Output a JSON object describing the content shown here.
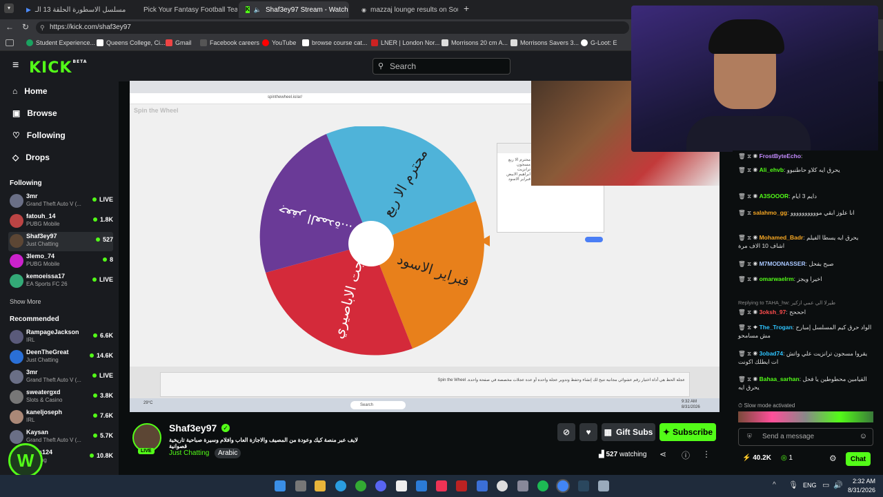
{
  "browser": {
    "tabs": [
      {
        "label": "مسلسل الاسطورة الحلقة 13 الـ"
      },
      {
        "label": "Pick Your Fantasy Football Team |"
      },
      {
        "label": "Shaf3ey97 Stream - Watch Li"
      },
      {
        "label": "mazzaj lounge results on Sou"
      }
    ],
    "url": "https://kick.com/shaf3ey97",
    "bookmarks": [
      "Student Experience...",
      "Queens College, Ci...",
      "Gmail",
      "Facebook careers",
      "YouTube",
      "browse course cat...",
      "LNER | London Nor...",
      "Morrisons 20 cm A...",
      "Morrisons Savers 3...",
      "G-Loot: E"
    ]
  },
  "header": {
    "logo": "KICK",
    "logo_badge": "BETA",
    "search_placeholder": "Search"
  },
  "sidebar": {
    "nav": [
      {
        "label": "Home"
      },
      {
        "label": "Browse"
      },
      {
        "label": "Following"
      },
      {
        "label": "Drops"
      }
    ],
    "following_title": "Following",
    "following": [
      {
        "name": "3mr",
        "game": "Grand Theft Auto V (...",
        "viewers": "LIVE"
      },
      {
        "name": "fatouh_14",
        "game": "PUBG Mobile",
        "viewers": "1.8K"
      },
      {
        "name": "Shaf3ey97",
        "game": "Just Chatting",
        "viewers": "527"
      },
      {
        "name": "3lemo_74",
        "game": "PUBG Mobile",
        "viewers": "8"
      },
      {
        "name": "kemoeissa17",
        "game": "EA Sports FC 26",
        "viewers": "LIVE"
      }
    ],
    "show_more": "Show More",
    "recommended_title": "Recommended",
    "recommended": [
      {
        "name": "RampageJackson",
        "game": "IRL",
        "viewers": "6.6K"
      },
      {
        "name": "DeenTheGreat",
        "game": "Just Chatting",
        "viewers": "14.6K"
      },
      {
        "name": "3mr",
        "game": "Grand Theft Auto V (...",
        "viewers": "LIVE"
      },
      {
        "name": "sweatergxd",
        "game": "Slots & Casino",
        "viewers": "3.8K"
      },
      {
        "name": "kaneljoseph",
        "game": "IRL",
        "viewers": "7.6K"
      },
      {
        "name": "Kaysan",
        "game": "Grand Theft Auto V (...",
        "viewers": "5.7K"
      },
      {
        "name": "clues124",
        "game": "Chatting",
        "viewers": "10.8K"
      }
    ]
  },
  "stream_screen": {
    "wheel_title": "Spin the Wheel",
    "inner_url": "spinthewheel.io/ar/",
    "segments": [
      "محترم الا ربع",
      "فبراير الاسود",
      "بهجت الاباصيري",
      "...جعفر العمدة"
    ],
    "entries_text": "محترم الا ربع\nمسجون ترانزيت\nابراهيم الابيض\nفبراير الاسود",
    "description": "عجلة الحظ هي أداة اختيار رقم عشوائي مجانية تتيح لك إنشاء وحفظ وتدوير عجلة واحدة أو عدة عجلات مخصصة في صفحة واحدة. Spin the Wheel",
    "inner_taskbar_search": "Search",
    "inner_time": "9:32 AM",
    "inner_date": "8/31/2026",
    "inner_weather": "29°C"
  },
  "channel": {
    "name": "Shaf3ey97",
    "live_badge": "LIVE",
    "title": "لايف عبر منصة كيك وعودة من المصيف والاجازة العاب وافلام وسيرة صباحية تاريخية قصوانية",
    "category": "Just Chatting",
    "language_tag": "Arabic",
    "watching_count": "527",
    "watching_label": "watching",
    "gift_label": "Gift Subs",
    "subscribe_label": "Subscribe"
  },
  "chat": {
    "messages": [
      {
        "user": "FrostByteEcho",
        "text": "",
        "color": "#c58cff"
      },
      {
        "user": "Ali_ehvb",
        "text": "يحرق ايه كلاو حاطنبوو",
        "color": "#53fc18"
      },
      {
        "user": "A3SOOOR",
        "text": "دايم 3 ايام",
        "color": "#53fc18"
      },
      {
        "user": "salahmo_gg",
        "text": "انا علوز ابقي موووووووووو",
        "color": "#f5a623"
      },
      {
        "user": "Mohamed_Badr",
        "text": "يحرق ايه يسطا الفيلم اشاف 10 الاف مرة",
        "color": "#f5a623"
      },
      {
        "user": "M7MODNASSER",
        "text": "صبح بفحل",
        "color": "#a9c7ff"
      },
      {
        "user": "omarwaelrm",
        "text": "اخيرا ويجز",
        "color": "#53fc18"
      },
      {
        "user": "3oksh_97",
        "text": "احححح",
        "color": "#ff4d4d",
        "reply": "Replying to TAHA_hw: طيرلا الي عمي ازكير"
      },
      {
        "user": "The_Trogan",
        "text": "الواد حرق كيم المسلسل إمبارح مش مسامحو",
        "color": "#2ec4ff"
      },
      {
        "user": "3obad74",
        "text": "يقروا مسجون ترانزيت علي واتش ات ايطلك اكونت",
        "color": "#2ec4ff"
      },
      {
        "user": "Bahaa_sarhan",
        "text": "القيامين محطوطين يا فحل يحرق ايه",
        "color": "#53fc18"
      }
    ],
    "slow_mode": "Slow mode activated",
    "input_placeholder": "Send a message",
    "points": "40.2K",
    "second_count": "1",
    "chat_button": "Chat"
  },
  "taskbar": {
    "lang": "ENG",
    "time": "2:32 AM",
    "date": "8/31/2026"
  }
}
